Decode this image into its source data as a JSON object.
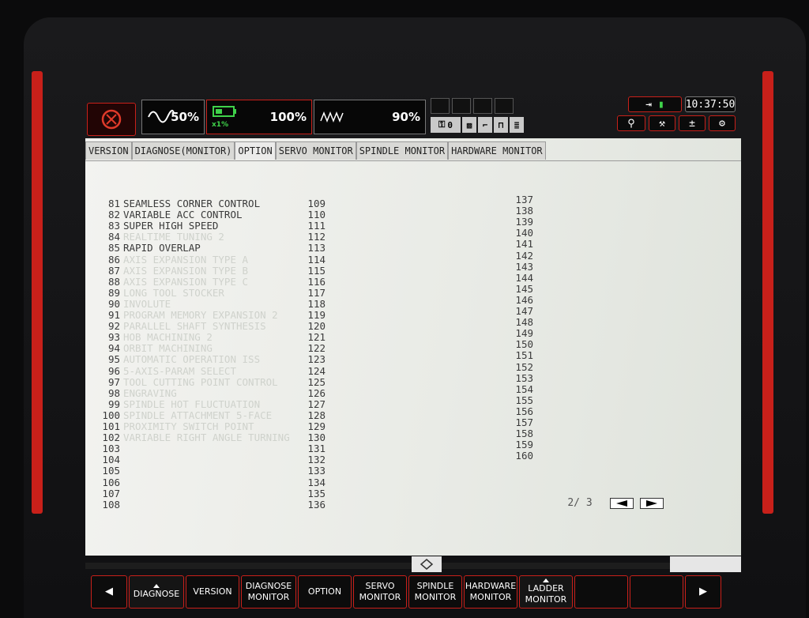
{
  "status": {
    "gauges": [
      {
        "label": "50%",
        "icon": "sine-wave-icon"
      },
      {
        "label": "100%",
        "sub": "x1%",
        "icon": "battery-icon"
      },
      {
        "label": "90%",
        "icon": "zigzag-wave-icon"
      }
    ],
    "key_count": "0",
    "clock": "10:37:50"
  },
  "tabs": [
    "VERSION",
    "DIAGNOSE(MONITOR)",
    "OPTION",
    "SERVO MONITOR",
    "SPINDLE MONITOR",
    "HARDWARE MONITOR"
  ],
  "options": [
    {
      "no": "81",
      "name": "SEAMLESS CORNER CONTROL",
      "dim": false
    },
    {
      "no": "82",
      "name": "VARIABLE ACC CONTROL",
      "dim": false
    },
    {
      "no": "83",
      "name": "SUPER HIGH SPEED",
      "dim": false
    },
    {
      "no": "84",
      "name": "REALTIME TUNING 2",
      "dim": true
    },
    {
      "no": "85",
      "name": "RAPID OVERLAP",
      "dim": false
    },
    {
      "no": "86",
      "name": "AXIS EXPANSION TYPE A",
      "dim": true
    },
    {
      "no": "87",
      "name": "AXIS EXPANSION TYPE B",
      "dim": true
    },
    {
      "no": "88",
      "name": "AXIS EXPANSION TYPE C",
      "dim": true
    },
    {
      "no": "89",
      "name": "LONG TOOL STOCKER",
      "dim": true
    },
    {
      "no": "90",
      "name": "INVOLUTE",
      "dim": true
    },
    {
      "no": "91",
      "name": "PROGRAM MEMORY EXPANSION 2",
      "dim": true
    },
    {
      "no": "92",
      "name": "PARALLEL SHAFT SYNTHESIS",
      "dim": true
    },
    {
      "no": "93",
      "name": "HOB MACHINING 2",
      "dim": true
    },
    {
      "no": "94",
      "name": "ORBIT MACHINING",
      "dim": true
    },
    {
      "no": "95",
      "name": "AUTOMATIC OPERATION ISS",
      "dim": true
    },
    {
      "no": "96",
      "name": "5-AXIS-PARAM SELECT",
      "dim": true
    },
    {
      "no": "97",
      "name": "TOOL CUTTING POINT CONTROL",
      "dim": true
    },
    {
      "no": "98",
      "name": "ENGRAVING",
      "dim": true
    },
    {
      "no": "99",
      "name": "SPINDLE HOT FLUCTUATION",
      "dim": true
    },
    {
      "no": "100",
      "name": "SPINDLE ATTACHMENT 5-FACE",
      "dim": true
    },
    {
      "no": "101",
      "name": "PROXIMITY SWITCH POINT",
      "dim": true
    },
    {
      "no": "102",
      "name": "VARIABLE RIGHT ANGLE TURNING",
      "dim": true
    },
    {
      "no": "103",
      "name": "",
      "dim": false
    },
    {
      "no": "104",
      "name": "",
      "dim": false
    },
    {
      "no": "105",
      "name": "",
      "dim": false
    },
    {
      "no": "106",
      "name": "",
      "dim": false
    },
    {
      "no": "107",
      "name": "",
      "dim": false
    },
    {
      "no": "108",
      "name": "",
      "dim": false
    }
  ],
  "col2": [
    "109",
    "110",
    "111",
    "112",
    "113",
    "114",
    "115",
    "116",
    "117",
    "118",
    "119",
    "120",
    "121",
    "122",
    "123",
    "124",
    "125",
    "126",
    "127",
    "128",
    "129",
    "130",
    "131",
    "132",
    "133",
    "134",
    "135",
    "136"
  ],
  "col3": [
    "137",
    "138",
    "139",
    "140",
    "141",
    "142",
    "143",
    "144",
    "145",
    "146",
    "147",
    "148",
    "149",
    "150",
    "151",
    "152",
    "153",
    "154",
    "155",
    "156",
    "157",
    "158",
    "159",
    "160"
  ],
  "pager": {
    "page": "2/ 3"
  },
  "softkeys": [
    {
      "id": "prev",
      "l1": "",
      "l2": "",
      "arrow": "◀"
    },
    {
      "id": "diagnose",
      "l1": "DIAGNOSE",
      "l2": "",
      "tri": true
    },
    {
      "id": "version",
      "l1": "VERSION",
      "l2": ""
    },
    {
      "id": "diagnose-monitor",
      "l1": "DIAGNOSE",
      "l2": "MONITOR"
    },
    {
      "id": "option",
      "l1": "OPTION",
      "l2": ""
    },
    {
      "id": "servo-monitor",
      "l1": "SERVO",
      "l2": "MONITOR"
    },
    {
      "id": "spindle-monitor",
      "l1": "SPINDLE",
      "l2": "MONITOR"
    },
    {
      "id": "hardware-monitor",
      "l1": "HARDWARE",
      "l2": "MONITOR"
    },
    {
      "id": "ladder-monitor",
      "l1": "LADDER",
      "l2": "MONITOR",
      "tri": true
    },
    {
      "id": "blank1",
      "l1": "",
      "l2": ""
    },
    {
      "id": "blank2",
      "l1": "",
      "l2": ""
    },
    {
      "id": "next",
      "l1": "",
      "l2": "",
      "arrow": "▶"
    }
  ],
  "colors": {
    "accent": "#c8201a",
    "screen": "#ecedea",
    "text": "#3a3a3a",
    "dim": "#cfd2cc"
  }
}
